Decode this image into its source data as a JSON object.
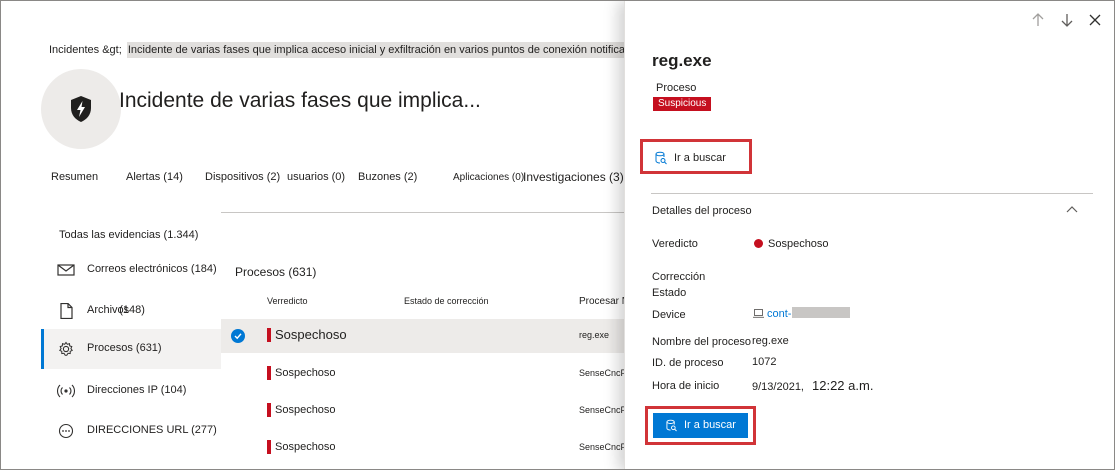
{
  "breadcrumb": {
    "parent": "Incidentes &gt;",
    "current": "Incidente de varias fases que implica acceso inicial y exfiltración en varios puntos de conexión notificados por varios"
  },
  "incident": {
    "icon": "shield-lightning-icon",
    "title": "Incidente de varias fases que implica..."
  },
  "tabs": [
    {
      "label": "Resumen"
    },
    {
      "label": "Alertas (14)"
    },
    {
      "label": "Dispositivos (2)"
    },
    {
      "label": "usuarios (0)"
    },
    {
      "label": "Buzones (2)"
    },
    {
      "label": "Aplicaciones (0)"
    },
    {
      "label": "Investigaciones (3)"
    }
  ],
  "evidence": {
    "title": "Todas las evidencias (1.344)",
    "items": [
      {
        "label": "Correos electrónicos (184)",
        "icon": "mail-icon"
      },
      {
        "label": "Archivos",
        "count": "(148)",
        "icon": "file-icon"
      },
      {
        "label": "Procesos (631)",
        "icon": "gear-icon",
        "active": true
      },
      {
        "label": "Direcciones IP (104)",
        "icon": "broadcast-icon"
      },
      {
        "label": "DIRECCIONES URL (277)",
        "icon": "globe-icon"
      }
    ]
  },
  "processes": {
    "title": "Procesos (631)",
    "columns": [
      "Verredicto",
      "Estado de corrección",
      "Procesar Ni"
    ],
    "rows": [
      {
        "verdict": "Sospechoso",
        "process": "reg.exe",
        "selected": true
      },
      {
        "verdict": "Sospechoso",
        "process": "SenseCncP"
      },
      {
        "verdict": "Sospechoso",
        "process": "SenseCncP"
      },
      {
        "verdict": "Sospechoso",
        "process": "SenseCncP"
      }
    ]
  },
  "panel": {
    "name": "reg.exe",
    "type": "Proceso",
    "badge": "Suspicious",
    "hunt_link": "Ir a buscar",
    "details_title": "Detalles del proceso",
    "fields": {
      "verdict_label": "Veredicto",
      "verdict_value": "Sospechoso",
      "remediation_label_1": "Corrección",
      "remediation_label_2": "Estado",
      "device_label": "Device",
      "device_value": "cont-",
      "name_label": "Nombre del proceso",
      "name_value": "reg.exe",
      "pid_label": "ID. de proceso",
      "pid_value": "1072",
      "start_label": "Hora de inicio",
      "start_date": "9/13/2021,",
      "start_time": "12:22 a.m."
    },
    "hunt_button": "Ir a buscar"
  },
  "colors": {
    "accent": "#0078d4",
    "danger": "#c50f1f",
    "highlight_box": "#d13438"
  }
}
